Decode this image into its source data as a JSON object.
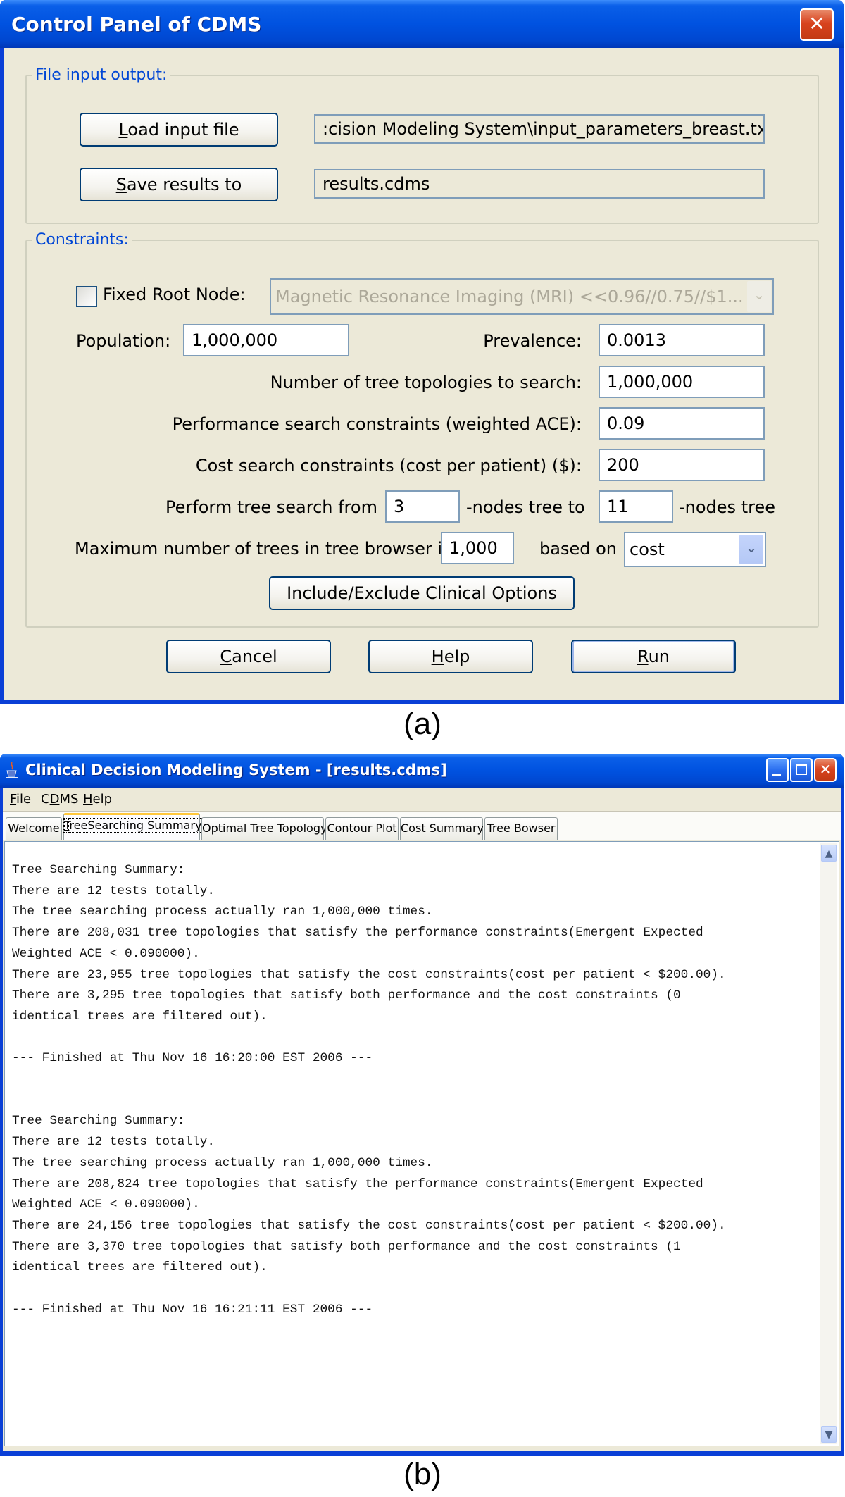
{
  "dialog": {
    "title": "Control Panel of CDMS",
    "file_group": {
      "legend": "File input output:",
      "load_button": {
        "mnemonic": "L",
        "rest": "oad input file"
      },
      "load_path": ":cision Modeling System\\input_parameters_breast.txt",
      "save_button": {
        "mnemonic": "S",
        "rest": "ave results to"
      },
      "save_path": "results.cdms"
    },
    "constraints_group": {
      "legend": "Constraints:",
      "fixed_root_node": {
        "label": "Fixed Root Node:",
        "checked": false,
        "selected": "Magnetic Resonance Imaging (MRI) <<0.96//0.75//$1..."
      },
      "population": {
        "label": "Population:",
        "value": "1,000,000"
      },
      "prevalence": {
        "label": "Prevalence:",
        "value": "0.0013"
      },
      "topologies": {
        "label": "Number of tree topologies to search:",
        "value": "1,000,000"
      },
      "performance": {
        "label": "Performance search constraints (weighted ACE):",
        "value": "0.09"
      },
      "cost": {
        "label": "Cost search constraints (cost per patient) ($):",
        "value": "200"
      },
      "tree_search": {
        "prefix": "Perform tree search from",
        "from_value": "3",
        "middle": "-nodes tree to",
        "to_value": "11",
        "suffix": "-nodes tree"
      },
      "max_trees": {
        "prefix": "Maximum number of trees in tree browser is",
        "value": "1,000",
        "middle": "based on",
        "sort_by": "cost"
      },
      "include_exclude_button": "Include/Exclude Clinical Options"
    },
    "buttons": {
      "cancel": {
        "mnemonic": "C",
        "rest": "ancel"
      },
      "help": {
        "mnemonic": "H",
        "rest": "elp"
      },
      "run": {
        "mnemonic": "R",
        "rest": "un"
      }
    },
    "caption": "(a)"
  },
  "main_window": {
    "title": "Clinical Decision Modeling System - [results.cdms]",
    "menu": [
      {
        "pre": "",
        "mnemonic": "F",
        "rest": "ile"
      },
      {
        "pre": "C",
        "mnemonic": "D",
        "rest": "MS"
      },
      {
        "pre": "",
        "mnemonic": "H",
        "rest": "elp"
      }
    ],
    "tabs": [
      {
        "pre": "",
        "mnemonic": "W",
        "rest": "elcome",
        "active": false
      },
      {
        "pre": "",
        "mnemonic": "T",
        "rest": "reeSearching Summary",
        "active": true
      },
      {
        "pre": "",
        "mnemonic": "O",
        "rest": "ptimal Tree Topology",
        "active": false
      },
      {
        "pre": "",
        "mnemonic": "C",
        "rest": "ontour Plot",
        "active": false
      },
      {
        "pre": "Co",
        "mnemonic": "s",
        "rest": "t Summary",
        "active": false
      },
      {
        "pre": "Tree ",
        "mnemonic": "B",
        "rest": "owser",
        "active": false
      }
    ],
    "summary_text": "Tree Searching Summary:\nThere are 12 tests totally.\nThe tree searching process actually ran 1,000,000 times.\nThere are 208,031 tree topologies that satisfy the performance constraints(Emergent Expected\nWeighted ACE < 0.090000).\nThere are 23,955 tree topologies that satisfy the cost constraints(cost per patient < $200.00).\nThere are 3,295 tree topologies that satisfy both performance and the cost constraints (0\nidentical trees are filtered out).\n\n--- Finished at Thu Nov 16 16:20:00 EST 2006 ---\n\n\nTree Searching Summary:\nThere are 12 tests totally.\nThe tree searching process actually ran 1,000,000 times.\nThere are 208,824 tree topologies that satisfy the performance constraints(Emergent Expected\nWeighted ACE < 0.090000).\nThere are 24,156 tree topologies that satisfy the cost constraints(cost per patient < $200.00).\nThere are 3,370 tree topologies that satisfy both performance and the cost constraints (1\nidentical trees are filtered out).\n\n--- Finished at Thu Nov 16 16:21:11 EST 2006 ---",
    "caption": "(b)"
  },
  "icons": {
    "close": "✕",
    "chevron_down": "⌄",
    "scroll_up": "▲",
    "scroll_down": "▼"
  }
}
